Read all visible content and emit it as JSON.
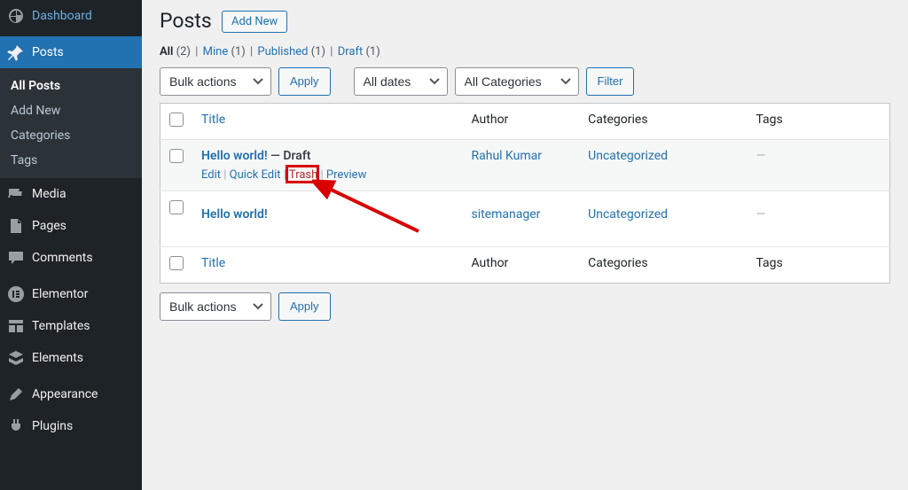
{
  "sidebar": {
    "dashboard": "Dashboard",
    "posts": "Posts",
    "posts_submenu": [
      "All Posts",
      "Add New",
      "Categories",
      "Tags"
    ],
    "media": "Media",
    "pages": "Pages",
    "comments": "Comments",
    "elementor": "Elementor",
    "templates": "Templates",
    "elements": "Elements",
    "appearance": "Appearance",
    "plugins": "Plugins"
  },
  "header": {
    "title": "Posts",
    "add_new": "Add New"
  },
  "status_links": [
    {
      "label": "All",
      "count": "(2)",
      "current": true
    },
    {
      "label": "Mine",
      "count": "(1)",
      "current": false
    },
    {
      "label": "Published",
      "count": "(1)",
      "current": false
    },
    {
      "label": "Draft",
      "count": "(1)",
      "current": false
    }
  ],
  "filters": {
    "bulk_label": "Bulk actions",
    "apply": "Apply",
    "dates": "All dates",
    "categories": "All Categories",
    "filter": "Filter"
  },
  "columns": {
    "title": "Title",
    "author": "Author",
    "categories": "Categories",
    "tags": "Tags"
  },
  "rows": [
    {
      "title": "Hello world!",
      "state": "Draft",
      "author": "Rahul Kumar",
      "category": "Uncategorized",
      "tags": "—",
      "hovered": true,
      "actions": {
        "edit": "Edit",
        "quick_edit": "Quick Edit",
        "trash": "Trash",
        "preview": "Preview"
      }
    },
    {
      "title": "Hello world!",
      "state": "",
      "author": "sitemanager",
      "category": "Uncategorized",
      "tags": "—",
      "hovered": false
    }
  ]
}
